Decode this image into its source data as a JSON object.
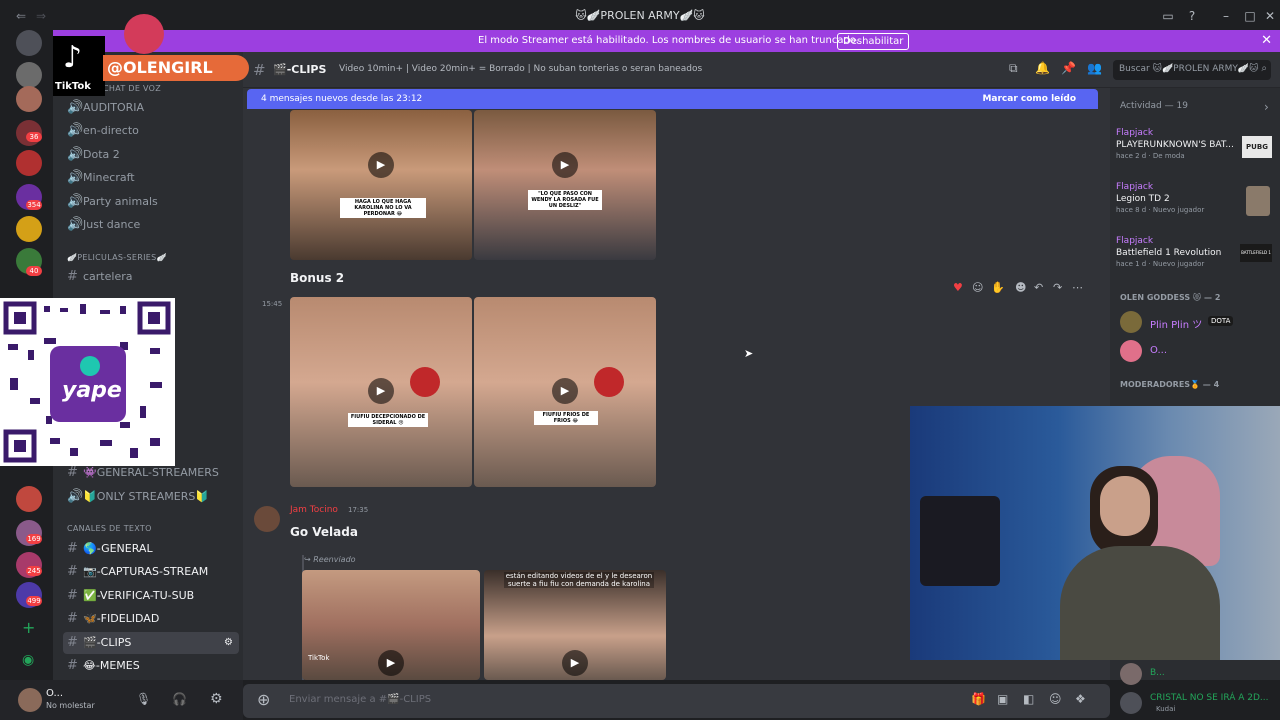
{
  "window": {
    "title": "🐱🪽PROLEN ARMY🪽🐱"
  },
  "streamer_banner": {
    "message": "El modo Streamer está habilitado. Los nombres de usuario se han truncado.",
    "disable_label": "Deshabilitar"
  },
  "overlay": {
    "tiktok_label": "TikTok",
    "handle": "@OLENGIRL",
    "qr_label": "yape"
  },
  "guild_badges": [
    "36",
    "354",
    "40",
    "169",
    "245",
    "499"
  ],
  "channels": {
    "items_top": [
      "AUDITORIA",
      "en-directo",
      "Dota 2",
      "Minecraft",
      "Party animals",
      "Just dance"
    ],
    "cat_voice": "CHAT DE VOZ",
    "cat_movies": "🪽PELICULAS-SERIES🪽",
    "cartelera": "cartelera",
    "streamer_items": [
      "👾GENERAL-STREAMERS",
      "🔰ONLY STREAMERS🔰"
    ],
    "cat_text": "CANALES DE TEXTO",
    "text_items": [
      "🌎-GENERAL",
      "📷-CAPTURAS-STREAM",
      "✅-VERIFICA-TU-SUB",
      "🦋-FIDELIDAD",
      "🎬-CLIPS",
      "😂-MEMES"
    ]
  },
  "user": {
    "name": "O...",
    "status": "No molestar"
  },
  "topbar": {
    "channel": "🎬-CLIPS",
    "topic": "Video 10min+ | Video 20min+ = Borrado | No suban tonterias o seran baneados",
    "search_placeholder": "Buscar 🐱🪽PROLEN ARMY🪽🐱"
  },
  "new_messages": {
    "text": "4 mensajes nuevos desde las 23:12",
    "mark_read": "Marcar como leído"
  },
  "messages": [
    {
      "captions": [
        "HAGA LO QUE HAGA KAROLINA NO LO VA PERDONAR 😂",
        "\"LO QUE PASO CON WENDY LA ROSADA FUE UN DESLIZ\""
      ]
    },
    {
      "time": "15:45",
      "title": "Bonus 2",
      "captions": [
        "FIUFIU DECEPCIONADO DE SIDERAL 😢",
        "FIUFIU FRIOS DE FRIOS 😂"
      ]
    },
    {
      "author": "Jam Tocino",
      "time": "17:35",
      "title": "Go Velada",
      "forwarded": "Reenviado",
      "captions": [
        "TikTok",
        "están editando videos de el y le desearon suerte a fiu fiu con demanda de karolina"
      ]
    }
  ],
  "composer": {
    "placeholder": "Enviar mensaje a #🎬-CLIPS"
  },
  "activity": {
    "header": "Actividad — 19",
    "items": [
      {
        "user": "Flapjack",
        "game": "PLAYERUNKNOWN'S BAT...",
        "meta": "hace 2 d · De moda",
        "icon": "PUBG"
      },
      {
        "user": "Flapjack",
        "game": "Legion TD 2",
        "meta": "hace 8 d · Nuevo jugador",
        "icon": ""
      },
      {
        "user": "Flapjack",
        "game": "Battlefield 1 Revolution",
        "meta": "hace 1 d · Nuevo jugador",
        "icon": "BATTLEFIELD 1"
      }
    ],
    "group_goddess": "OLEN GODDESS 😻 — 2",
    "members": [
      {
        "name": "Plin Plin ツ",
        "badge": "DOTA"
      },
      {
        "name": "O..."
      }
    ],
    "group_mods": "MODERADORES🏅 — 4",
    "bottom_members": [
      {
        "name": "B..."
      },
      {
        "name": "CRISTAL NO SE IRÁ A 2D...",
        "sub": "Kudai"
      }
    ]
  },
  "colors": {
    "accent": "#5865f2",
    "banner": "#9c3fe0",
    "bg": "#313338",
    "sidebar": "#2b2d31"
  }
}
